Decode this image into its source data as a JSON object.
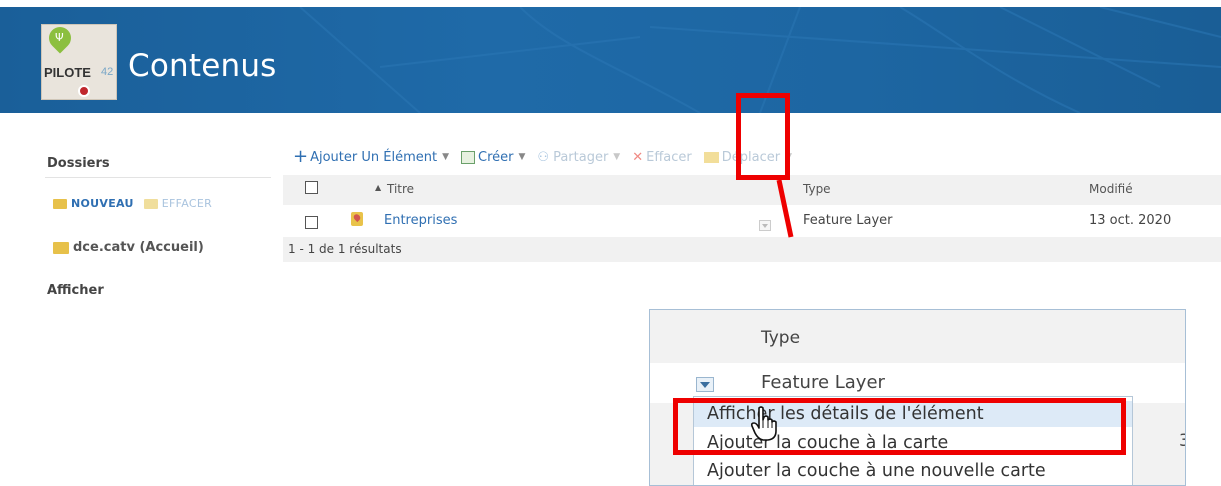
{
  "header": {
    "logo": {
      "text": "PILOTE",
      "number": "42"
    },
    "title": "Contenus"
  },
  "sidebar": {
    "folders_heading": "Dossiers",
    "new_label": "NOUVEAU",
    "delete_label": "EFFACER",
    "home_folder": "dce.catv (Accueil)",
    "show_heading": "Afficher"
  },
  "toolbar": {
    "add": "Ajouter Un Élément",
    "create": "Créer",
    "share": "Partager",
    "delete": "Effacer",
    "move": "Déplacer"
  },
  "table": {
    "columns": {
      "title": "Titre",
      "type": "Type",
      "modified": "Modifié"
    },
    "rows": [
      {
        "title": "Entreprises",
        "type": "Feature Layer",
        "modified": "13 oct. 2020"
      }
    ],
    "results": "1 - 1 de 1 résultats"
  },
  "inset": {
    "type_header": "Type",
    "type_value": "Feature Layer",
    "edge_digit": "3",
    "menu": [
      "Afficher les détails de l'élément",
      "Ajouter la couche à la carte",
      "Ajouter la couche à une nouvelle carte"
    ]
  },
  "colors": {
    "banner": "#1f6aa8",
    "link": "#2f6fb2",
    "annotation": "#ee0000",
    "menu_highlight": "#ddeaf7"
  }
}
